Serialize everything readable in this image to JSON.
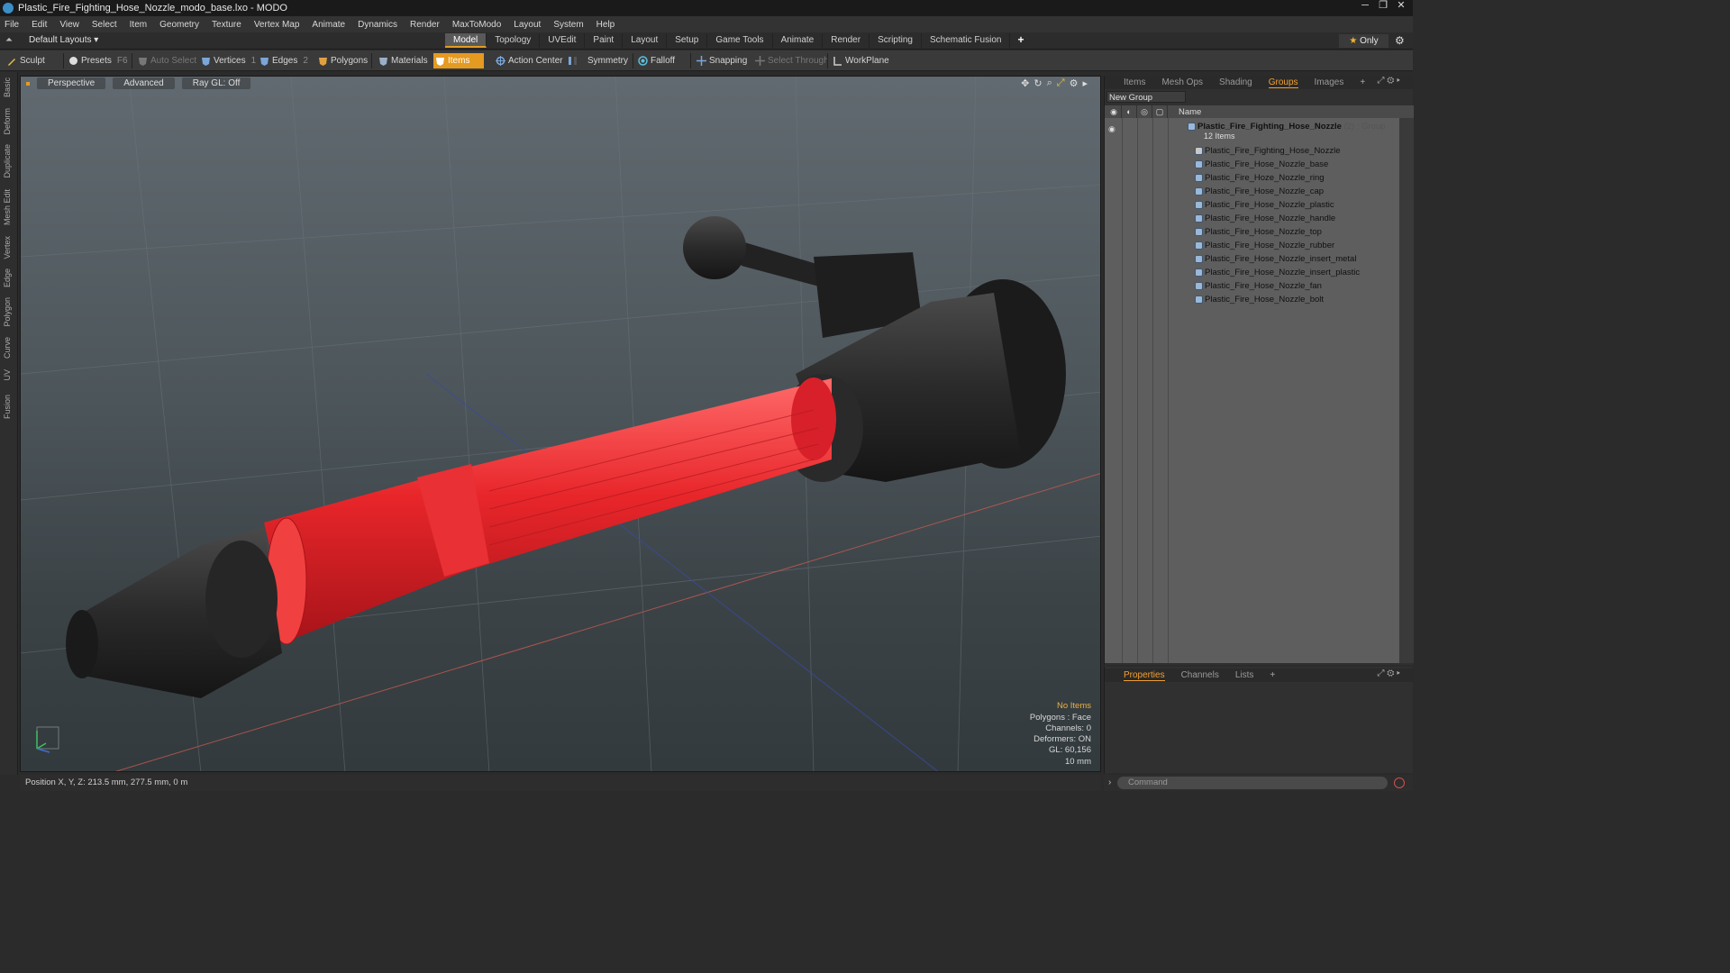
{
  "window": {
    "title": "Plastic_Fire_Fighting_Hose_Nozzle_modo_base.lxo - MODO"
  },
  "menu": [
    "File",
    "Edit",
    "View",
    "Select",
    "Item",
    "Geometry",
    "Texture",
    "Vertex Map",
    "Animate",
    "Dynamics",
    "Render",
    "MaxToModo",
    "Layout",
    "System",
    "Help"
  ],
  "layout": {
    "default_layouts": "Default Layouts ▾",
    "tabs": [
      "Model",
      "Topology",
      "UVEdit",
      "Paint",
      "Layout",
      "Setup",
      "Game Tools",
      "Animate",
      "Render",
      "Scripting",
      "Schematic Fusion"
    ],
    "active_tab": "Model",
    "plus": "+",
    "only_label": "Only"
  },
  "toolbar": {
    "sculpt": "Sculpt",
    "presets": "Presets",
    "presets_key": "F6",
    "auto_select": "Auto Select",
    "vertices": "Vertices",
    "vertices_key": "1",
    "edges": "Edges",
    "edges_key": "2",
    "polygons": "Polygons",
    "materials": "Materials",
    "items": "Items",
    "action_center": "Action Center",
    "symmetry": "Symmetry",
    "falloff": "Falloff",
    "snapping": "Snapping",
    "select_through": "Select Through",
    "workplane": "WorkPlane"
  },
  "left_tabs": [
    "Basic",
    "Deform",
    "Duplicate",
    "Mesh Edit",
    "Vertex",
    "Edge",
    "Polygon",
    "Curve",
    "UV",
    "Fusion"
  ],
  "viewport": {
    "view": "Perspective",
    "mode": "Advanced",
    "raygl": "Ray GL: Off",
    "info": {
      "no_items": "No Items",
      "polygons": "Polygons : Face",
      "channels": "Channels: 0",
      "deformers": "Deformers: ON",
      "gl": "GL: 60,156",
      "scale": "10 mm"
    }
  },
  "status": {
    "position": "Position X, Y, Z:  213.5 mm, 277.5 mm, 0 m"
  },
  "groups_panel": {
    "tabs": [
      "Items",
      "Mesh Ops",
      "Shading",
      "Groups",
      "Images"
    ],
    "active_tab": "Groups",
    "plus": "+",
    "new_group": "New Group",
    "name_header": "Name",
    "group": {
      "name": "Plastic_Fire_Fighting_Hose_Nozzle",
      "count": "(2) : Group",
      "sub": "12 Items"
    },
    "items": [
      "Plastic_Fire_Fighting_Hose_Nozzle",
      "Plastic_Fire_Hose_Nozzle_base",
      "Plastic_Fire_Hoze_Nozzle_ring",
      "Plastic_Fire_Hose_Nozzle_cap",
      "Plastic_Fire_Hose_Nozzle_plastic",
      "Plastic_Fire_Hose_Nozzle_handle",
      "Plastic_Fire_Hose_Nozzle_top",
      "Plastic_Fire_Hose_Nozzle_rubber",
      "Plastic_Fire_Hose_Nozzle_insert_metal",
      "Plastic_Fire_Hose_Nozzle_insert_plastic",
      "Plastic_Fire_Hose_Nozzle_fan",
      "Plastic_Fire_Hose_Nozzle_bolt"
    ]
  },
  "properties_panel": {
    "tabs": [
      "Properties",
      "Channels",
      "Lists"
    ],
    "active_tab": "Properties",
    "plus": "+"
  },
  "command": {
    "placeholder": "Command"
  },
  "colors": {
    "accent": "#e59a20",
    "selection_red": "#e8262a",
    "viewport_top": "#616a70"
  }
}
